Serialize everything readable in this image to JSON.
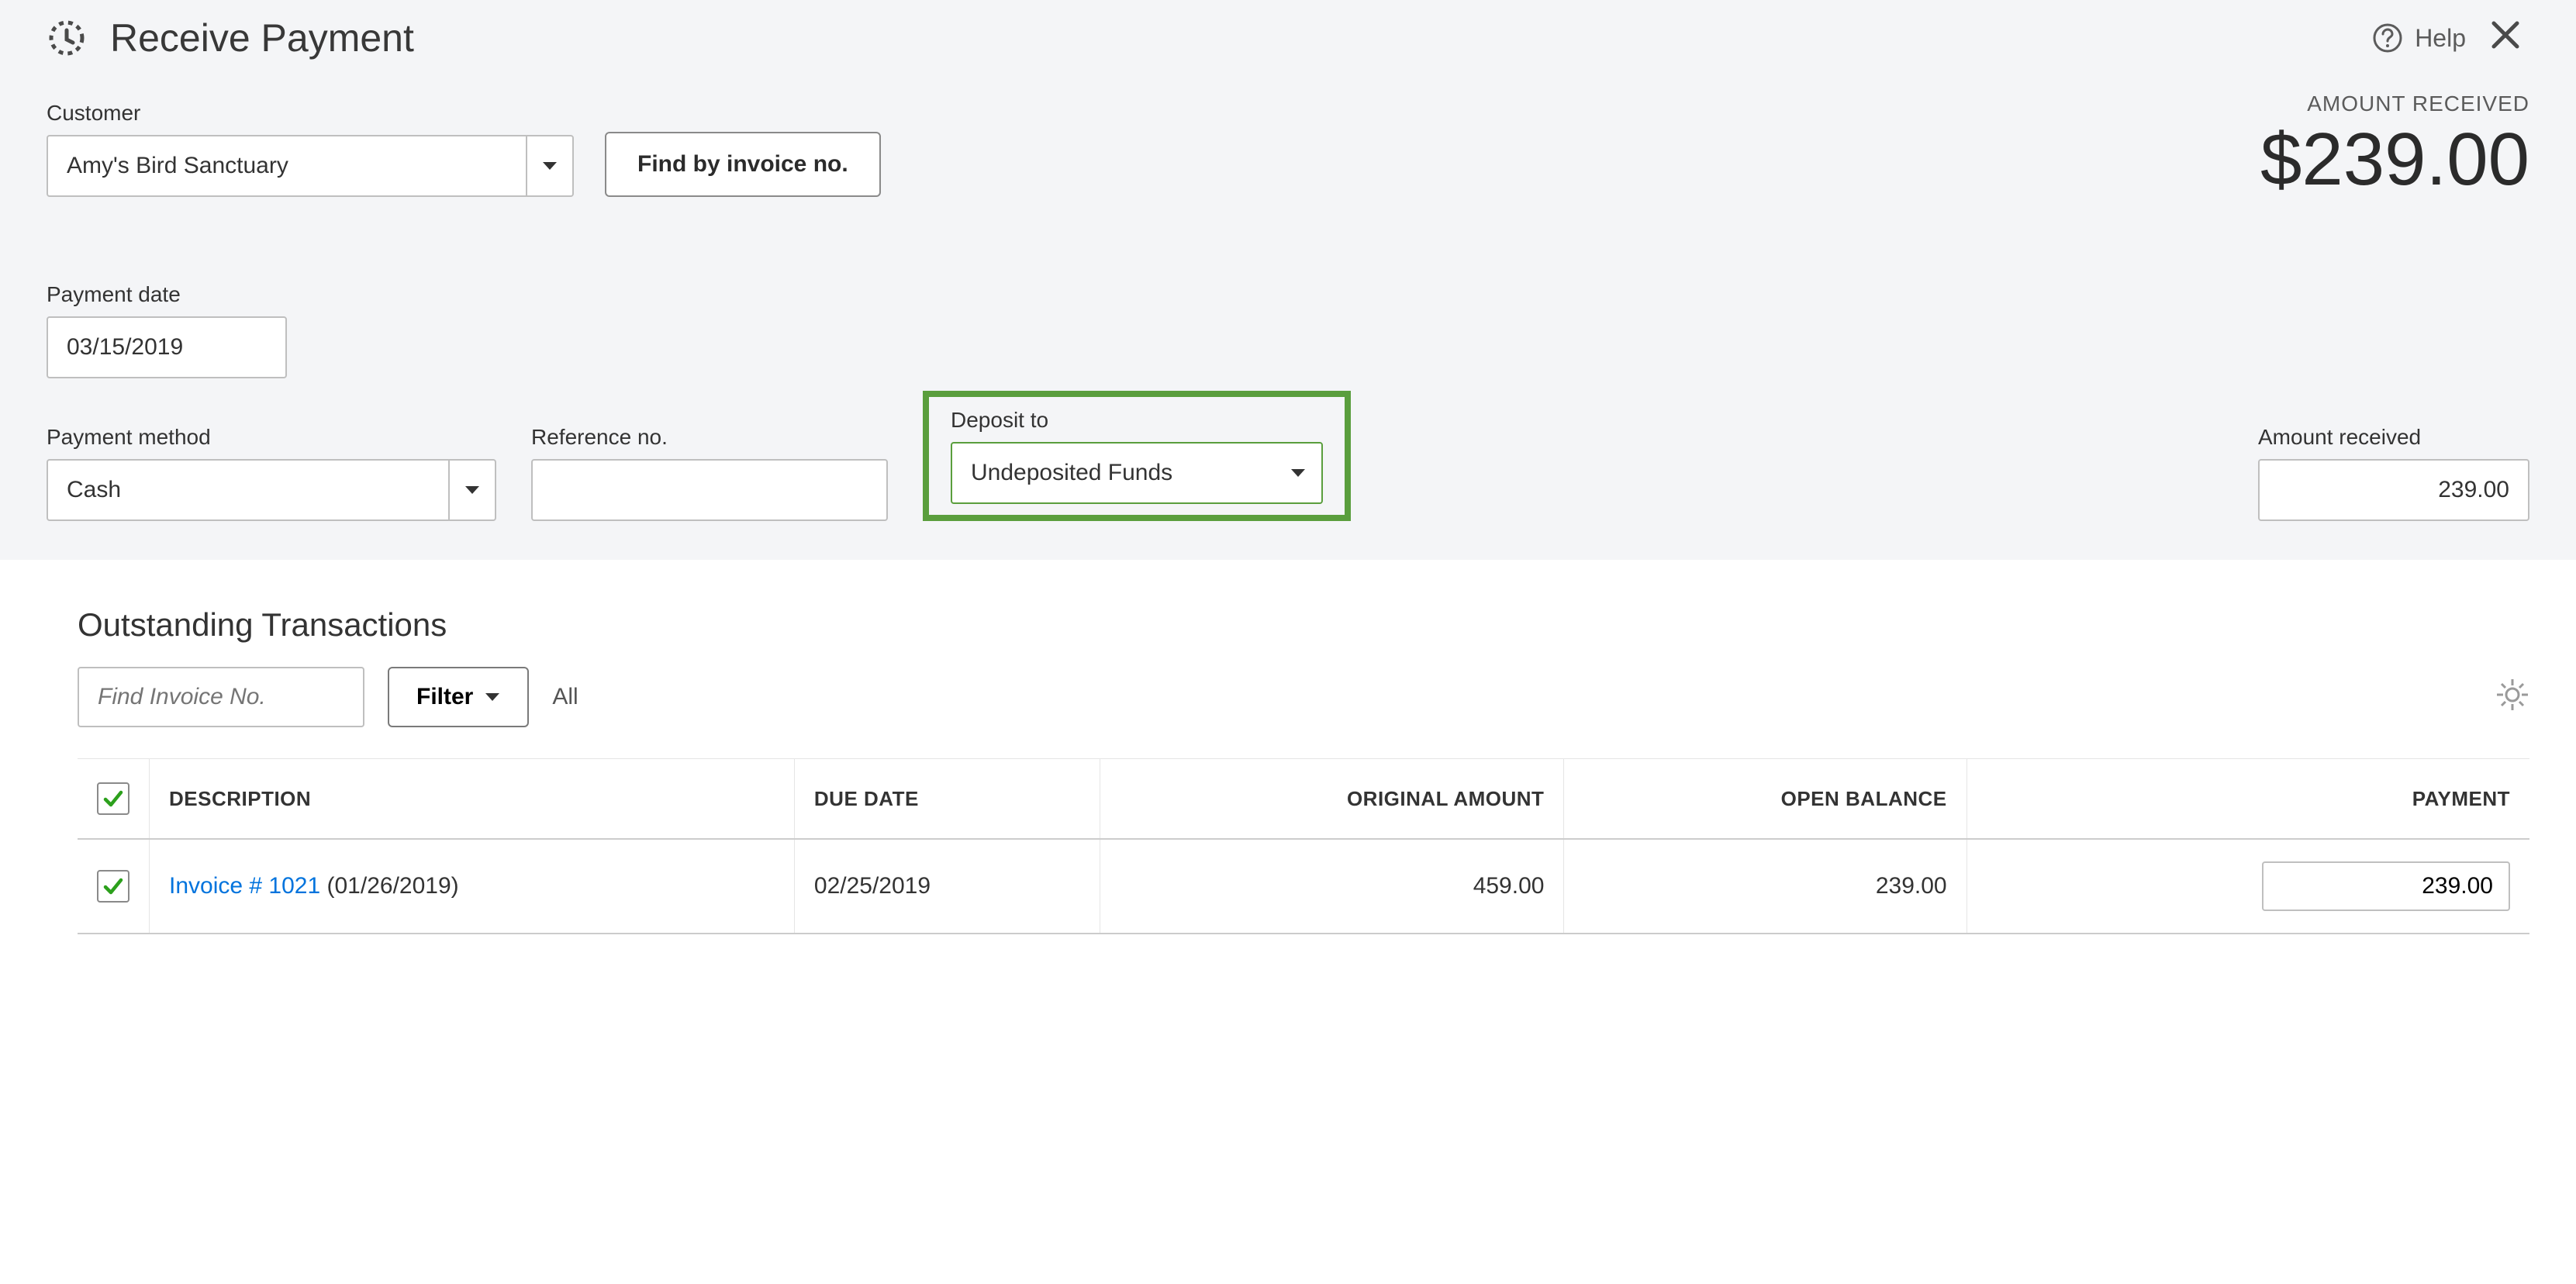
{
  "header": {
    "title": "Receive Payment",
    "help_label": "Help"
  },
  "customer": {
    "label": "Customer",
    "value": "Amy's Bird Sanctuary",
    "find_button": "Find by invoice no."
  },
  "amount_display": {
    "label": "AMOUNT RECEIVED",
    "value": "$239.00"
  },
  "payment_date": {
    "label": "Payment date",
    "value": "03/15/2019"
  },
  "payment_method": {
    "label": "Payment method",
    "value": "Cash"
  },
  "reference_no": {
    "label": "Reference no.",
    "value": ""
  },
  "deposit_to": {
    "label": "Deposit to",
    "value": "Undeposited Funds"
  },
  "amount_received": {
    "label": "Amount received",
    "value": "239.00"
  },
  "outstanding": {
    "title": "Outstanding Transactions",
    "find_placeholder": "Find Invoice No.",
    "filter_label": "Filter",
    "filter_applied": "All",
    "columns": {
      "description": "DESCRIPTION",
      "due_date": "DUE DATE",
      "original_amount": "ORIGINAL AMOUNT",
      "open_balance": "OPEN BALANCE",
      "payment": "PAYMENT"
    },
    "rows": [
      {
        "checked": true,
        "invoice_link": "Invoice # 1021",
        "invoice_date": "(01/26/2019)",
        "due_date": "02/25/2019",
        "original_amount": "459.00",
        "open_balance": "239.00",
        "payment": "239.00"
      }
    ]
  }
}
